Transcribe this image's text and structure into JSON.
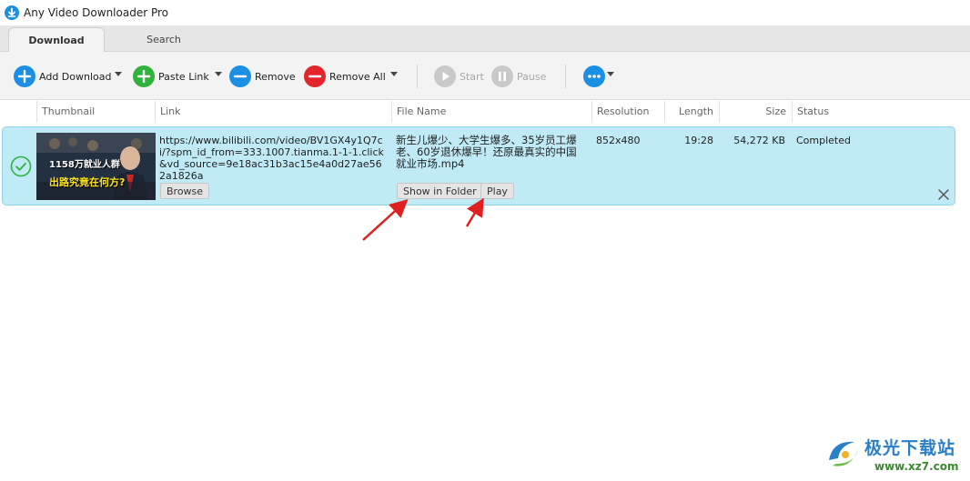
{
  "window": {
    "title": "Any Video Downloader Pro"
  },
  "tabs": [
    {
      "label": "Download",
      "active": true
    },
    {
      "label": "Search",
      "active": false
    }
  ],
  "toolbar": {
    "add_download": "Add Download",
    "paste_link": "Paste Link",
    "remove": "Remove",
    "remove_all": "Remove All",
    "start": "Start",
    "pause": "Pause"
  },
  "columns": {
    "thumbnail": "Thumbnail",
    "link": "Link",
    "file_name": "File Name",
    "resolution": "Resolution",
    "length": "Length",
    "size": "Size",
    "status": "Status"
  },
  "downloads": [
    {
      "thumbnail_text_1": "1158万就业人群",
      "thumbnail_text_2": "出路究竟在何方?",
      "link": "https://www.bilibili.com/video/BV1GX4y1Q7ci/?spm_id_from=333.1007.tianma.1-1-1.click&vd_source=9e18ac31b3ac15e4a0d27ae562a1826a",
      "file_name": "新生儿爆少、大学生爆多、35岁员工爆老、60岁退休爆早！还原最真实的中国就业市场.mp4",
      "resolution": "852x480",
      "length": "19:28",
      "size": "54,272 KB",
      "status": "Completed",
      "browse_label": "Browse",
      "show_in_folder_label": "Show in Folder",
      "play_label": "Play"
    }
  ],
  "watermark": {
    "name": "极光下载站",
    "url": "www.xz7.com"
  },
  "colors": {
    "accent_blue": "#1a8fe3",
    "green": "#2fb33a",
    "red": "#e3262c",
    "row_highlight": "#bfeaf6",
    "annotation_red": "#e02020"
  }
}
